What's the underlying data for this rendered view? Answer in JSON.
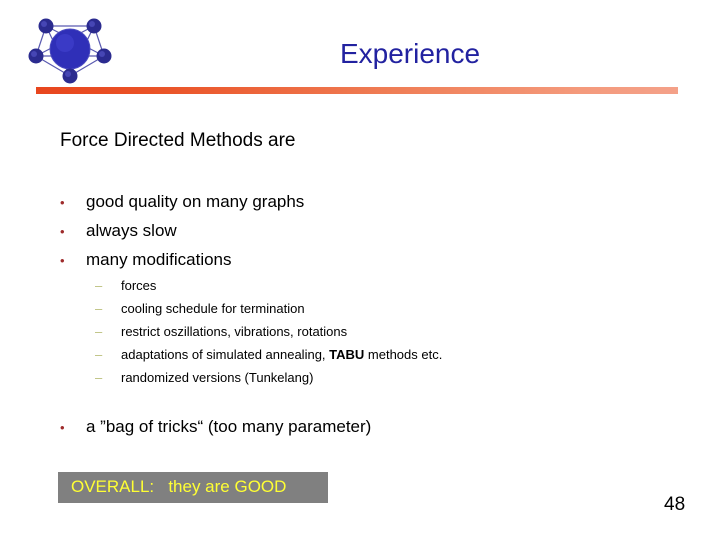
{
  "slide": {
    "title": "Experience",
    "intro": "Force Directed Methods are",
    "page_number": "48"
  },
  "logo": {
    "name": "graph-network-logo",
    "node_color": "#2b2b8f",
    "center_color": "#2a2ab4",
    "edge_color": "#5a5ab0"
  },
  "colors": {
    "title": "#2222a0",
    "bullet": "#9e2b2b",
    "dash": "#b9bf7a",
    "divider_start": "#e8461e",
    "divider_end": "#f4a189",
    "callout_bg": "#808080",
    "callout_text": "#ffff33"
  },
  "bullets": {
    "marker": "•",
    "level1": [
      {
        "text": "good quality on many graphs"
      },
      {
        "text": "always slow"
      },
      {
        "text": "many modifications"
      }
    ],
    "closing": {
      "text": "a ”bag of tricks“  (too many parameter)"
    }
  },
  "sub_bullets": {
    "marker": "–",
    "items": [
      {
        "pre": "forces",
        "bold": "",
        "post": ""
      },
      {
        "pre": "cooling schedule for termination",
        "bold": "",
        "post": ""
      },
      {
        "pre": "restrict oszillations, vibrations, rotations",
        "bold": "",
        "post": ""
      },
      {
        "pre": "adaptations of simulated annealing, ",
        "bold": "TABU",
        "post": " methods etc."
      },
      {
        "pre": "randomized versions (Tunkelang)",
        "bold": "",
        "post": ""
      }
    ]
  },
  "callout": {
    "text": "OVERALL:   they are GOOD"
  }
}
